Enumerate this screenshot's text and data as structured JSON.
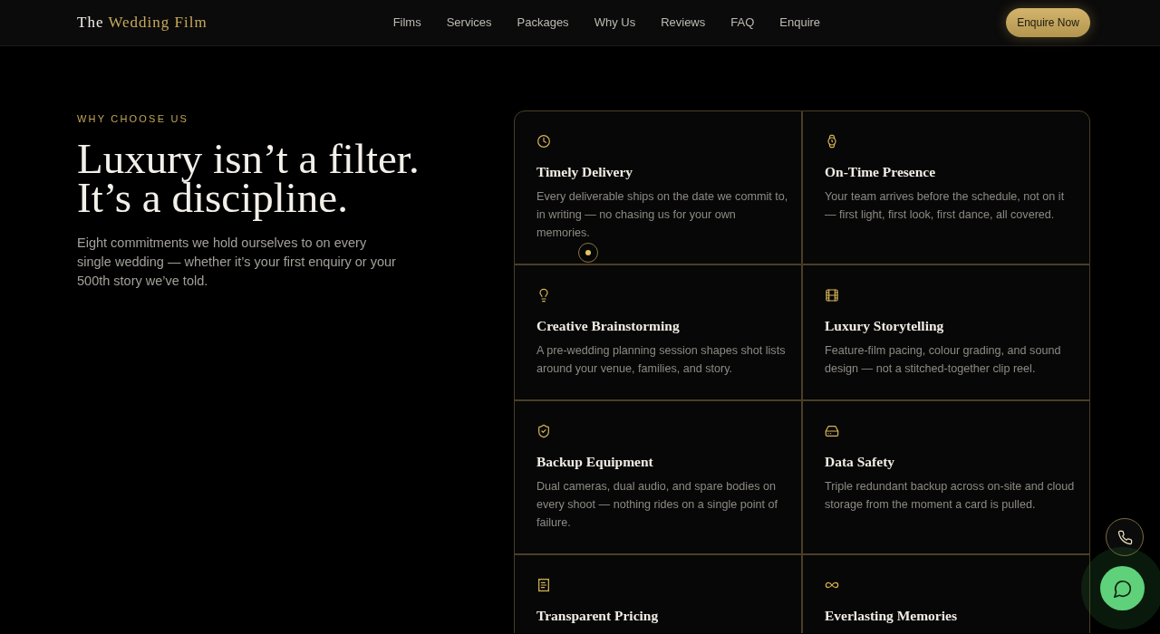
{
  "header": {
    "logo": {
      "lead": "The",
      "accent": "Wedding Film"
    },
    "nav": [
      "Films",
      "Services",
      "Packages",
      "Why Us",
      "Reviews",
      "FAQ",
      "Enquire"
    ],
    "cta": "Enquire Now"
  },
  "intro": {
    "eyebrow": "WHY CHOOSE US",
    "heading_lines": [
      "Luxury isn’t a filter.",
      "It’s a discipline."
    ],
    "description": "Eight commitments we hold ourselves to on every single wedding — whether it’s your first enquiry or your 500th story we’ve told."
  },
  "features": [
    {
      "title": "Timely Delivery",
      "description": "Every deliverable ships on the date we commit to, in writing — no chasing us for your own memories."
    },
    {
      "title": "On-Time Presence",
      "description": "Your team arrives before the schedule, not on it — first light, first look, first dance, all covered."
    },
    {
      "title": "Creative Brainstorming",
      "description": "A pre-wedding planning session shapes shot lists around your venue, families, and story."
    },
    {
      "title": "Luxury Storytelling",
      "description": "Feature-film pacing, colour grading, and sound design — not a stitched-together clip reel."
    },
    {
      "title": "Backup Equipment",
      "description": "Dual cameras, dual audio, and spare bodies on every shoot — nothing rides on a single point of failure."
    },
    {
      "title": "Data Safety",
      "description": "Triple redundant backup across on-site and cloud storage from the moment a card is pulled."
    },
    {
      "title": "Transparent Pricing"
    },
    {
      "title": "Everlasting Memories"
    }
  ]
}
